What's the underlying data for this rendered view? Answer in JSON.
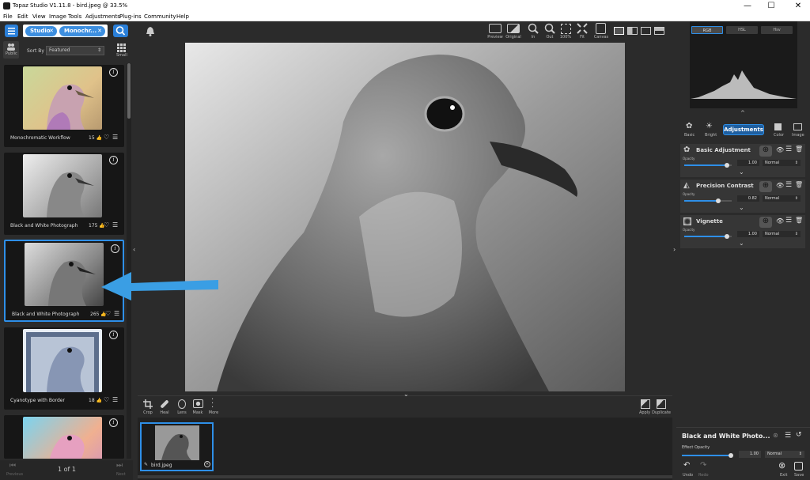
{
  "title_bar": {
    "title": "Topaz Studio V1.11.8 - bird.jpeg @ 33.5%",
    "minimize": "—",
    "maximize": "☐",
    "close": "✕"
  },
  "menu": [
    "File",
    "Edit",
    "View",
    "Image",
    "Tools",
    "Adjustments",
    "Plug-ins",
    "Community",
    "Help"
  ],
  "left_panel": {
    "filters": [
      "Studio",
      "Monochr..."
    ],
    "public_label": "Public",
    "sort_label": "Sort By",
    "sort_value": "Featured",
    "small_label": "Small",
    "cards": [
      {
        "name": "Monochromatic Workflow",
        "count": "15",
        "selected": false
      },
      {
        "name": "Black and White Photograph",
        "count": "175",
        "selected": false
      },
      {
        "name": "Black and White Photograph",
        "count": "265",
        "selected": true
      },
      {
        "name": "Cyanotype with Border",
        "count": "18",
        "selected": false
      }
    ],
    "pager": {
      "text": "1 of 1",
      "prev": "Previous",
      "next": "Next"
    }
  },
  "top_toolbar": {
    "items": [
      {
        "label": "Preview",
        "icon": "preview-icon"
      },
      {
        "label": "Original",
        "icon": "original-icon"
      },
      {
        "label": "In",
        "icon": "zoom-in-icon"
      },
      {
        "label": "Out",
        "icon": "zoom-out-icon"
      },
      {
        "label": "100%",
        "icon": "zoom-100-icon"
      },
      {
        "label": "Fit",
        "icon": "fit-icon"
      },
      {
        "label": "Canvas",
        "icon": "canvas-icon"
      }
    ]
  },
  "bottom_toolbar": {
    "tools": [
      {
        "label": "Crop",
        "icon": "crop-icon"
      },
      {
        "label": "Heal",
        "icon": "heal-icon"
      },
      {
        "label": "Lens",
        "icon": "lens-icon"
      },
      {
        "label": "Mask",
        "icon": "mask-icon"
      },
      {
        "label": "More",
        "icon": "more-icon"
      }
    ],
    "right_tools": [
      {
        "label": "Apply",
        "icon": "apply-icon"
      },
      {
        "label": "Duplicate",
        "icon": "duplicate-icon"
      }
    ]
  },
  "filmstrip": {
    "file_name": "bird.jpeg"
  },
  "right_panel": {
    "histogram_tabs": [
      "RGB",
      "HSL",
      "Hsv"
    ],
    "nav_tabs": [
      {
        "label": "Basic",
        "icon": "basic-icon"
      },
      {
        "label": "Bright",
        "icon": "bright-icon"
      },
      {
        "label": "Adjustments",
        "icon": "",
        "active": true
      },
      {
        "label": "Color",
        "icon": "color-icon"
      },
      {
        "label": "Image",
        "icon": "image-icon"
      }
    ],
    "adjustments": [
      {
        "name": "Basic Adjustment",
        "opacity_label": "Opacity",
        "value": "1.00",
        "blend": "Normal",
        "slider": 0.9
      },
      {
        "name": "Precision Contrast",
        "opacity_label": "Opacity",
        "value": "0.82",
        "blend": "Normal",
        "slider": 0.72
      },
      {
        "name": "Vignette",
        "opacity_label": "Opacity",
        "value": "1.00",
        "blend": "Normal",
        "slider": 0.9
      }
    ],
    "effect": {
      "title": "Black and White Photo...",
      "opacity_label": "Effect Opacity",
      "value": "1.00",
      "blend": "Normal",
      "undo": "Undo",
      "redo": "Redo",
      "exit": "Exit",
      "save": "Save"
    }
  },
  "colors": {
    "accent": "#2e8fe8",
    "panel": "#2b2b2b",
    "arrow": "#3a9ee4"
  }
}
